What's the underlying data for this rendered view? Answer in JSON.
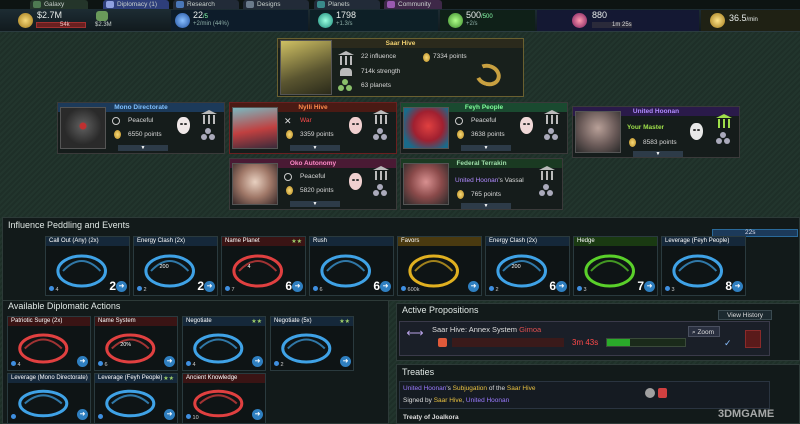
{
  "tabs": [
    {
      "label": "Galaxy",
      "color": "#4e7a52"
    },
    {
      "label": "Diplomacy (1)",
      "color": "#3d4f9a"
    },
    {
      "label": "Research",
      "color": "#3a4660"
    },
    {
      "label": "Designs",
      "color": "#3a4660"
    },
    {
      "label": "Planets",
      "color": "#3a4660"
    },
    {
      "label": "Community",
      "color": "#6a3a7a"
    }
  ],
  "resources": {
    "credits": "$2.7M",
    "credits_sub": "54k",
    "credits2": "$2.3M",
    "research": "22",
    "research_max": "/5",
    "research_rate": "+2/min (44%)",
    "energy": "1798",
    "energy_rate": "+1.3/s",
    "pop": "500",
    "pop_max": "/500",
    "pop_rate": "+2/s",
    "influence": "880",
    "influence_timer": "1m 25s",
    "income": "36.5",
    "income_unit": "/min"
  },
  "factions": {
    "main": {
      "name": "Saar Hive",
      "influence": "22 influence",
      "strength": "714k strength",
      "planets": "63 planets",
      "points": "7334 points"
    },
    "mono": {
      "name": "Mono Directorate",
      "status": "Peaceful",
      "points": "6550 points"
    },
    "nylli": {
      "name": "Nylli Hive",
      "status": "War",
      "points": "3359 points"
    },
    "feyh": {
      "name": "Feyh People",
      "status": "Peaceful",
      "points": "3638 points"
    },
    "hoonan": {
      "name": "United Hoonan",
      "status": "Your Master",
      "points": "8583 points"
    },
    "oko": {
      "name": "Oko Autonomy",
      "status": "Peaceful",
      "points": "5820 points"
    },
    "terrakin": {
      "name": "Federal Terrakin",
      "status_owner": "United Hoonan",
      "status_rest": "'s Vassal",
      "points": "765 points"
    }
  },
  "influence_section": {
    "title": "Influence Peddling and Events",
    "timer": "22s",
    "cards": [
      {
        "title": "Call Out (Any) (2x)",
        "count": "2",
        "small": "4",
        "color": "#3fa2e6"
      },
      {
        "title": "Energy Clash (2x)",
        "count": "2",
        "small": "2",
        "extra": "200",
        "color": "#3fa2e6"
      },
      {
        "title": "Name Planet",
        "count": "6",
        "small": "7",
        "extra": "4",
        "color": "#e04040"
      },
      {
        "title": "Rush",
        "count": "6",
        "small": "6",
        "color": "#3fa2e6"
      },
      {
        "title": "Favors",
        "count": "",
        "small": "600k",
        "color": "#e0b020"
      },
      {
        "title": "Energy Clash (2x)",
        "count": "6",
        "small": "2",
        "extra": "200",
        "color": "#3fa2e6"
      },
      {
        "title": "Hedge",
        "count": "7",
        "small": "3",
        "color": "#5ad02a"
      },
      {
        "title": "Leverage (Feyh People)",
        "count": "8",
        "small": "3",
        "color": "#3fa2e6"
      }
    ]
  },
  "actions_section": {
    "title": "Available Diplomatic Actions",
    "cards": [
      {
        "title": "Patriotic Surge (2x)",
        "small": "4",
        "color": "#e04040"
      },
      {
        "title": "Name System",
        "small": "6",
        "extra": "20%",
        "color": "#e04040"
      },
      {
        "title": "Negotiate",
        "small": "4",
        "color": "#3fa2e6"
      },
      {
        "title": "Negotiate (5x)",
        "small": "2",
        "color": "#3fa2e6"
      },
      {
        "title": "Leverage (Mono Directorate)",
        "small": "",
        "color": "#3fa2e6"
      },
      {
        "title": "Leverage (Feyh People)",
        "small": "",
        "color": "#3fa2e6"
      },
      {
        "title": "Ancient Knowledge",
        "small": "10",
        "color": "#e04040"
      }
    ]
  },
  "propositions": {
    "title": "Active Propositions",
    "history_label": "View History",
    "item_owner": "Saar Hive",
    "item_text": ": Annex System ",
    "item_target": "Gimoa",
    "zoom_label": "Zoom",
    "timer": "3m 43s"
  },
  "treaties": {
    "title": "Treaties",
    "t1_a": "United Hoonan",
    "t1_b": "'s ",
    "t1_c": "Subjugation",
    "t1_d": " of the ",
    "t1_e": "Saar Hive",
    "signed_prefix": "Signed by ",
    "signed_a": "Saar Hive",
    "signed_mid": ", ",
    "signed_b": "United Hoonan",
    "t2": "Treaty of Joalkora"
  },
  "watermark": "3DMGAME"
}
